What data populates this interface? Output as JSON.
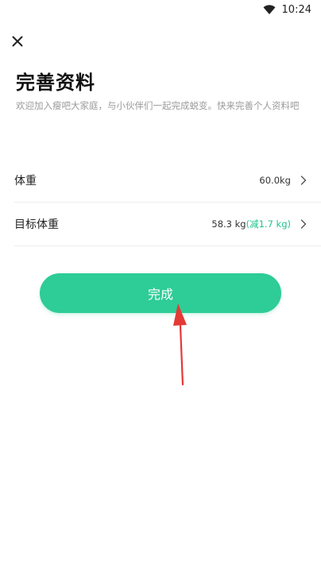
{
  "status_bar": {
    "time": "10:24"
  },
  "header": {
    "title": "完善资料",
    "subtitle": "欢迎加入瘦吧大家庭，与小伙伴们一起完成蜕变。快来完善个人资料吧"
  },
  "profile_fields": [
    {
      "label": "体重",
      "value": "60.0kg"
    },
    {
      "label": "目标体重",
      "value": "58.3 kg",
      "delta": "(减1.7 kg)"
    }
  ],
  "actions": {
    "done_label": "完成"
  },
  "colors": {
    "accent": "#2ecc97",
    "delta_text": "#20c38a",
    "annotation_arrow": "#e53935"
  },
  "icons": {
    "close": "close-icon",
    "chevron": "chevron-right-icon",
    "wifi": "wifi-icon"
  }
}
